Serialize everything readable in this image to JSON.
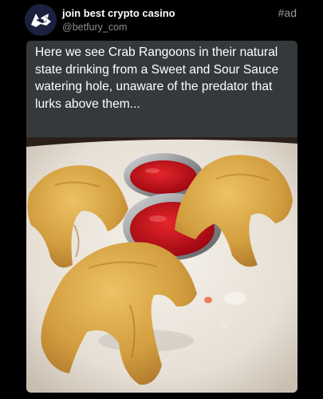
{
  "account": {
    "name": "join best crypto casino",
    "handle": "@betfury_com",
    "avatar_icon": "fox-logo-icon"
  },
  "ad_label": "#ad",
  "post": {
    "caption": "Here we see Crab Rangoons in their natural state drinking from a Sweet and Sour Sauce watering hole, unaware of the predator that lurks above them..."
  },
  "colors": {
    "background": "#000000",
    "bubble": "#35393b",
    "handle": "#8b8b8b",
    "sauce": "#c8101a",
    "rangoon": "#d9a646"
  }
}
